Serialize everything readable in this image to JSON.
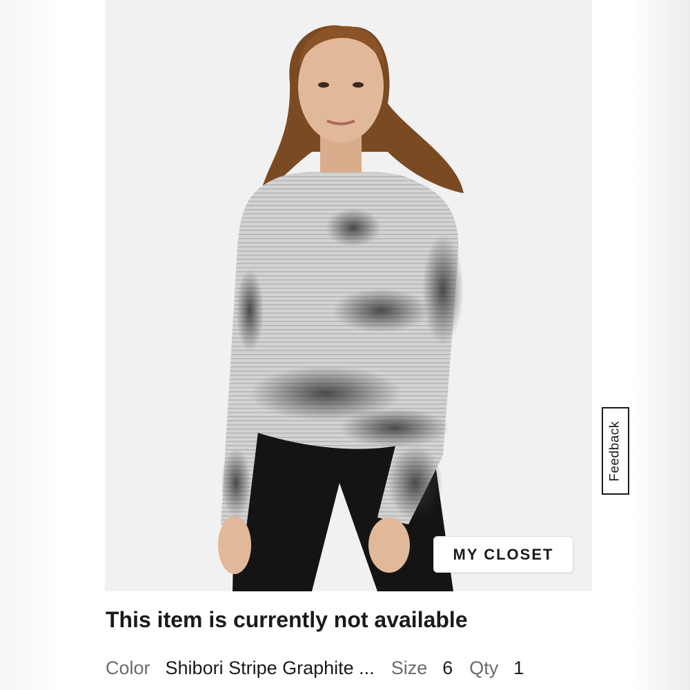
{
  "closet_button": {
    "label": "MY CLOSET"
  },
  "feedback": {
    "label": "Feedback"
  },
  "status": {
    "message": "This item is currently not available"
  },
  "details": {
    "color_label": "Color",
    "color_value": "Shibori Stripe Graphite ...",
    "size_label": "Size",
    "size_value": "6",
    "qty_label": "Qty",
    "qty_value": "1"
  },
  "photo": {
    "icon": "product-photo",
    "colors": {
      "background": "#f1f1f1",
      "shirt": "#c9c9c9",
      "dye": "#555555",
      "leggings": "#141414",
      "hair": "#7a4a22",
      "skin": "#e2b89a"
    }
  }
}
